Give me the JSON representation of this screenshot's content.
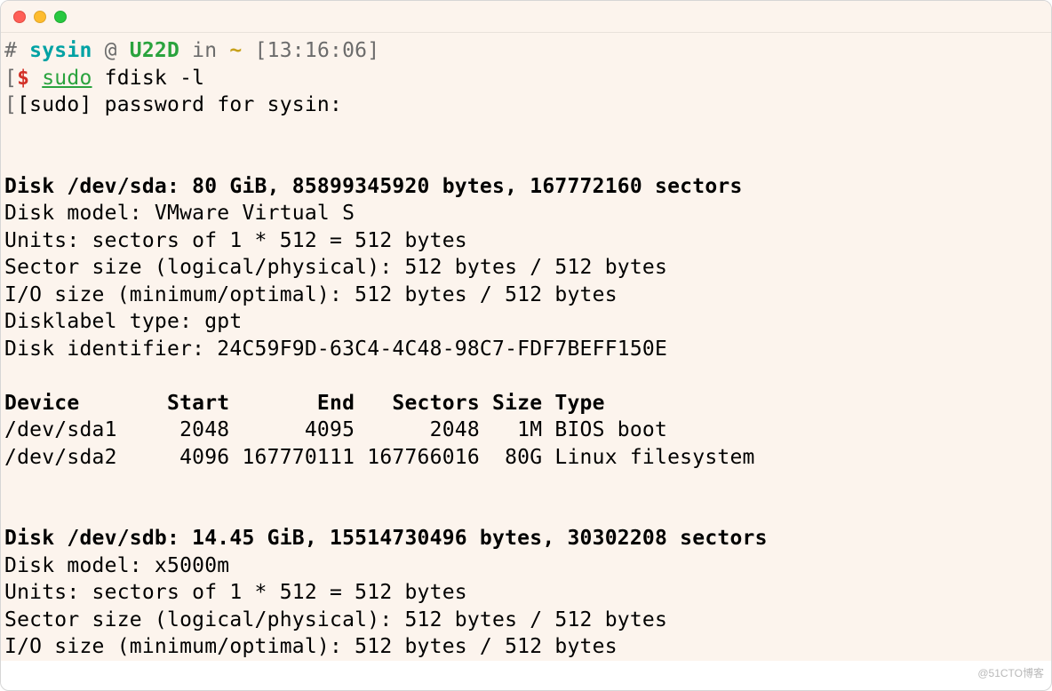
{
  "prompt": {
    "hash": "#",
    "user": "sysin",
    "at": "@",
    "host": "U22D",
    "inkw": "in",
    "path": "~",
    "time": "[13:16:06]",
    "dollar": "$",
    "cmd_sudo": "sudo",
    "cmd_rest": " fdisk -l",
    "sudo_line": "[sudo] password for sysin:"
  },
  "disk_a": {
    "header": "Disk /dev/sda: 80 GiB, 85899345920 bytes, 167772160 sectors",
    "model": "Disk model: VMware Virtual S",
    "units": "Units: sectors of 1 * 512 = 512 bytes",
    "sector": "Sector size (logical/physical): 512 bytes / 512 bytes",
    "io": "I/O size (minimum/optimal): 512 bytes / 512 bytes",
    "label": "Disklabel type: gpt",
    "ident": "Disk identifier: 24C59F9D-63C4-4C48-98C7-FDF7BEFF150E"
  },
  "table": {
    "header": "Device       Start       End   Sectors Size Type",
    "row1": "/dev/sda1     2048      4095      2048   1M BIOS boot",
    "row2": "/dev/sda2     4096 167770111 167766016  80G Linux filesystem"
  },
  "disk_b": {
    "header": "Disk /dev/sdb: 14.45 GiB, 15514730496 bytes, 30302208 sectors",
    "model": "Disk model: x5000m",
    "units": "Units: sectors of 1 * 512 = 512 bytes",
    "sector": "Sector size (logical/physical): 512 bytes / 512 bytes",
    "io": "I/O size (minimum/optimal): 512 bytes / 512 bytes"
  },
  "watermark": "@51CTO博客"
}
